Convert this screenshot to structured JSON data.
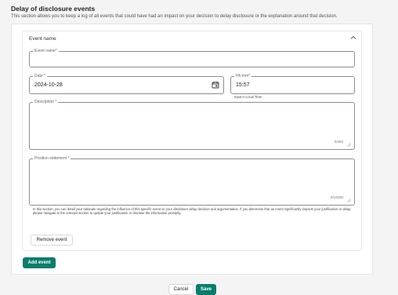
{
  "page": {
    "title": "Delay of disclosure events",
    "subtitle": "This section allows you to keep a log of all events that could have had an impact on your decision to delay disclosure or the explanation around that decision."
  },
  "event": {
    "header": "Event name",
    "expanded": true,
    "event_name": {
      "label": "Event name*",
      "value": ""
    },
    "date": {
      "label": "Date *",
      "value": "2024-10-28"
    },
    "time": {
      "label": "Hh:mm*",
      "value": "15:57",
      "helper": "Input in Local Time"
    },
    "description": {
      "label": "Description *",
      "value": "",
      "counter": "0/255"
    },
    "position_statement": {
      "label": "Position statement *",
      "value": "",
      "counter": "0/10000",
      "helper": "In this section, you can detail your rationale regarding the influence of this specific event on your disclosure delay decision and argumentation. If you determine that an event significantly impacts your justification or delay, please navigate to the relevant section to update your justification or disclose the information promptly."
    },
    "remove_label": "Remove event"
  },
  "actions": {
    "add_event_label": "Add event",
    "cancel_label": "Cancel",
    "save_label": "Save"
  },
  "colors": {
    "primary": "#0a7d6c",
    "border": "#8d8d8d",
    "background": "#f4f4f4"
  }
}
